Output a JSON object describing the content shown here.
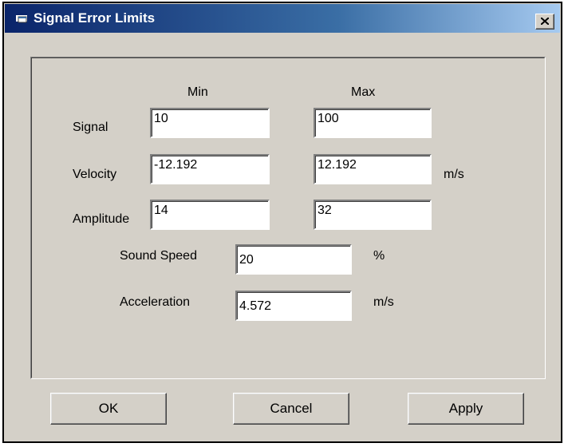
{
  "window": {
    "title": "Signal Error Limits",
    "close_label": "close"
  },
  "headers": {
    "min": "Min",
    "max": "Max"
  },
  "rows": [
    {
      "label": "Signal",
      "min": "10",
      "max": "100",
      "unit": ""
    },
    {
      "label": "Velocity",
      "min": "-12.192",
      "max": "12.192",
      "unit": "m/s"
    },
    {
      "label": "Amplitude",
      "min": "14",
      "max": "32",
      "unit": ""
    }
  ],
  "sound_speed": {
    "label": "Sound Speed",
    "value": "20",
    "unit": "%"
  },
  "acceleration": {
    "label": "Acceleration",
    "value": "4.572",
    "unit": "m/s"
  },
  "buttons": {
    "ok": "OK",
    "cancel": "Cancel",
    "apply": "Apply"
  },
  "colors": {
    "titlebar_start": "#0a246a",
    "titlebar_end": "#a6caf0",
    "face": "#d4d0c8"
  },
  "icons": {
    "app": "dialog-window-icon",
    "close": "close-x-icon"
  }
}
